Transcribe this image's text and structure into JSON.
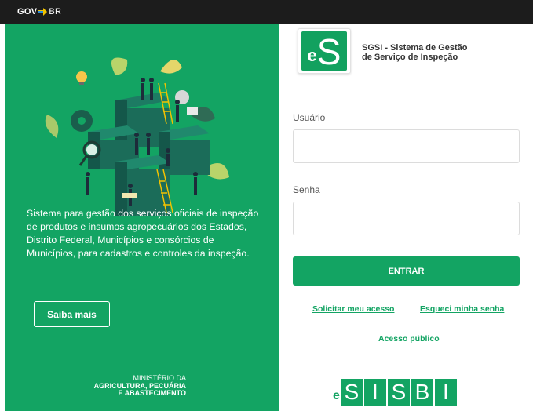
{
  "topbar": {
    "gov": "GOV",
    "br": "BR"
  },
  "left": {
    "description": "Sistema para gestão dos serviços oficiais de inspeção de produtos e insumos agropecuários dos Estados, Distrito Federal, Municípios e consórcios de Municípios, para cadastros e controles da inspeção.",
    "saiba_label": "Saiba mais",
    "ministerio_line1": "MINISTÉRIO DA",
    "ministerio_line2": "AGRICULTURA, PECUÁRIA",
    "ministerio_line3": "E ABASTECIMENTO"
  },
  "app": {
    "logo_e": "e",
    "logo_s": "S",
    "title_line1": "SGSI - Sistema de Gestão",
    "title_line2": "de Serviço de Inspeção"
  },
  "form": {
    "usuario_label": "Usuário",
    "usuario_value": "",
    "senha_label": "Senha",
    "senha_value": "",
    "entrar_label": "ENTRAR",
    "solicitar_label": "Solicitar meu acesso",
    "esqueci_label": "Esqueci minha senha",
    "acesso_publico_label": "Acesso público"
  },
  "sisbi": {
    "e": "e",
    "letters": [
      "S",
      "I",
      "S",
      "B",
      "I"
    ]
  },
  "colors": {
    "primary": "#13a463",
    "topbar": "#1c1c1c",
    "text": "#333333"
  }
}
